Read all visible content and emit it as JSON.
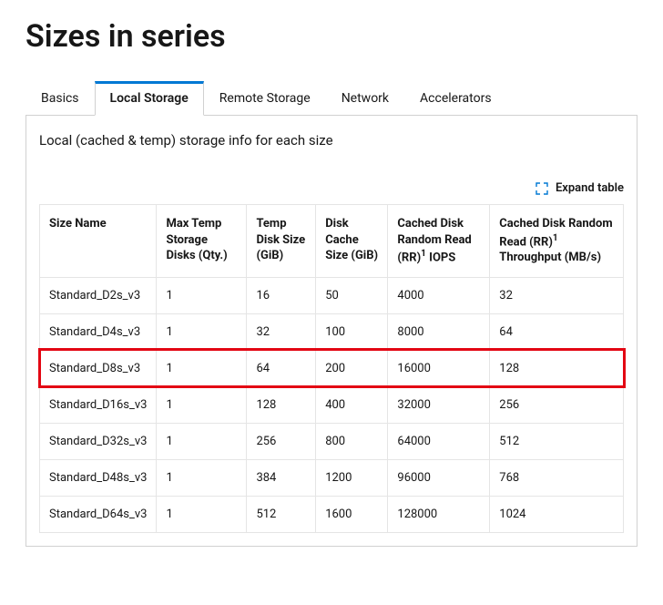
{
  "page_title": "Sizes in series",
  "tabs": [
    {
      "label": "Basics",
      "active": false
    },
    {
      "label": "Local Storage",
      "active": true
    },
    {
      "label": "Remote Storage",
      "active": false
    },
    {
      "label": "Network",
      "active": false
    },
    {
      "label": "Accelerators",
      "active": false
    }
  ],
  "panel": {
    "description": "Local (cached & temp) storage info for each size",
    "expand_label": "Expand table"
  },
  "table": {
    "headers": {
      "col0": "Size Name",
      "col1": "Max Temp Storage Disks (Qty.)",
      "col2": "Temp Disk Size (GiB)",
      "col3": "Disk Cache Size (GiB)",
      "col4_pre": "Cached Disk Random Read (RR)",
      "col4_sup": "1",
      "col4_post": " IOPS",
      "col5_pre": "Cached Disk Random Read (RR)",
      "col5_sup": "1",
      "col5_post": " Throughput (MB/s)"
    },
    "rows": [
      {
        "name": "Standard_D2s_v3",
        "qty": "1",
        "temp": "16",
        "cache": "50",
        "iops": "4000",
        "tput": "32",
        "highlight": false
      },
      {
        "name": "Standard_D4s_v3",
        "qty": "1",
        "temp": "32",
        "cache": "100",
        "iops": "8000",
        "tput": "64",
        "highlight": false
      },
      {
        "name": "Standard_D8s_v3",
        "qty": "1",
        "temp": "64",
        "cache": "200",
        "iops": "16000",
        "tput": "128",
        "highlight": true
      },
      {
        "name": "Standard_D16s_v3",
        "qty": "1",
        "temp": "128",
        "cache": "400",
        "iops": "32000",
        "tput": "256",
        "highlight": false
      },
      {
        "name": "Standard_D32s_v3",
        "qty": "1",
        "temp": "256",
        "cache": "800",
        "iops": "64000",
        "tput": "512",
        "highlight": false
      },
      {
        "name": "Standard_D48s_v3",
        "qty": "1",
        "temp": "384",
        "cache": "1200",
        "iops": "96000",
        "tput": "768",
        "highlight": false
      },
      {
        "name": "Standard_D64s_v3",
        "qty": "1",
        "temp": "512",
        "cache": "1600",
        "iops": "128000",
        "tput": "1024",
        "highlight": false
      }
    ]
  }
}
